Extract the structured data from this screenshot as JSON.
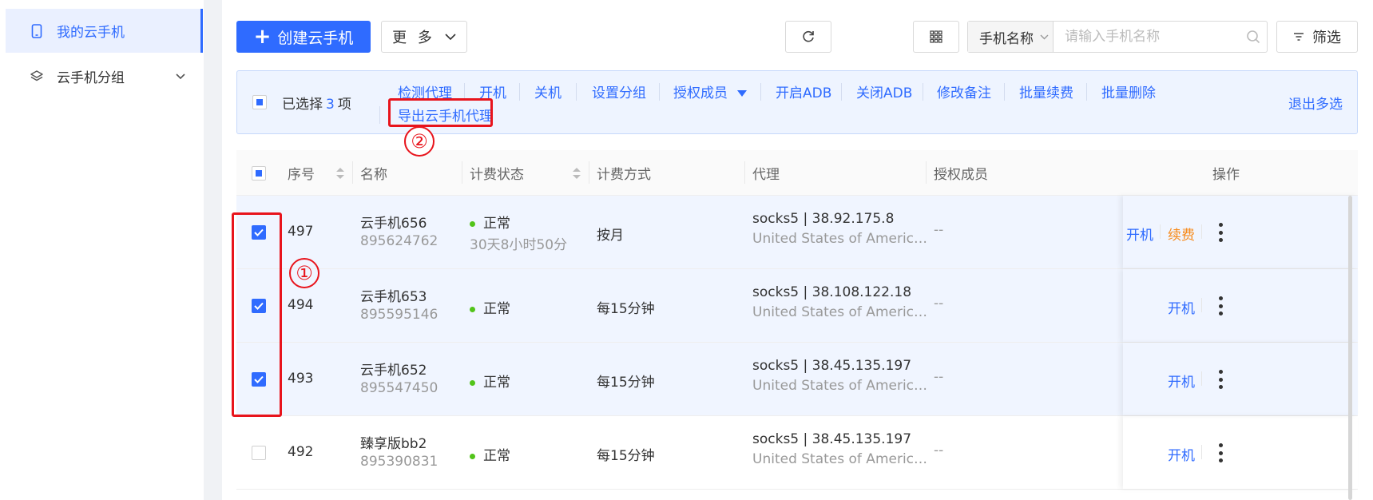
{
  "sidebar": {
    "items": [
      {
        "label": "我的云手机",
        "icon": "phone-icon"
      },
      {
        "label": "云手机分组",
        "icon": "layers-icon"
      }
    ]
  },
  "toolbar": {
    "create_label": "创建云手机",
    "more_label": "更 多",
    "search_field_label": "手机名称",
    "search_placeholder": "请输入手机名称",
    "filter_label": "筛选"
  },
  "batch": {
    "selected_prefix": "已选择",
    "selected_count": "3",
    "selected_suffix": "项",
    "actions": [
      "检测代理",
      "开机",
      "关机",
      "设置分组",
      "授权成员",
      "开启ADB",
      "关闭ADB",
      "修改备注",
      "批量续费",
      "批量删除"
    ],
    "export_label": "导出云手机代理",
    "exit_label": "退出多选"
  },
  "annotations": {
    "mark1": "①",
    "mark2": "②"
  },
  "table": {
    "headers": {
      "index": "序号",
      "name": "名称",
      "billing_status": "计费状态",
      "billing_method": "计费方式",
      "proxy": "代理",
      "members": "授权成员",
      "actions": "操作"
    },
    "rows": [
      {
        "index": "497",
        "name": "云手机656",
        "id": "895624762",
        "status": "正常",
        "remaining": "30天8小时50分",
        "method": "按月",
        "proxy": "socks5 | 38.92.175.8",
        "location": "United States of America,M...",
        "members": "--",
        "action": "开机",
        "renew": "续费",
        "selected": true
      },
      {
        "index": "494",
        "name": "云手机653",
        "id": "895595146",
        "status": "正常",
        "remaining": "",
        "method": "每15分钟",
        "proxy": "socks5 | 38.108.122.18",
        "location": "United States of America,N...",
        "members": "--",
        "action": "开机",
        "renew": "",
        "selected": true
      },
      {
        "index": "493",
        "name": "云手机652",
        "id": "895547450",
        "status": "正常",
        "remaining": "",
        "method": "每15分钟",
        "proxy": "socks5 | 38.45.135.197",
        "location": "United States of America,W...",
        "members": "--",
        "action": "开机",
        "renew": "",
        "selected": true
      },
      {
        "index": "492",
        "name": "臻享版bb2",
        "id": "895390831",
        "status": "正常",
        "remaining": "",
        "method": "每15分钟",
        "proxy": "socks5 | 38.45.135.197",
        "location": "United States of America,W...",
        "members": "--",
        "action": "开机",
        "renew": "",
        "selected": false
      }
    ]
  },
  "colors": {
    "primary": "#2f6bff",
    "highlight": "#e8141c",
    "status_ok": "#52c41a",
    "renew": "#f78b1c"
  }
}
